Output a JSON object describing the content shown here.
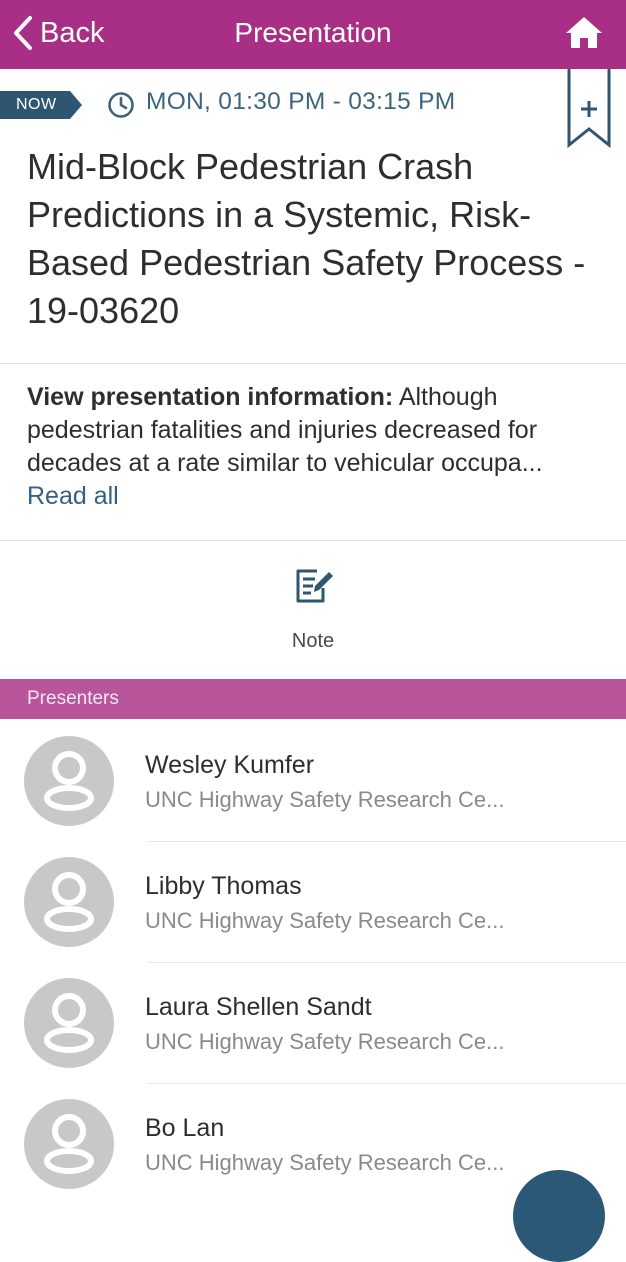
{
  "header": {
    "back_label": "Back",
    "title": "Presentation"
  },
  "session": {
    "now_badge": "NOW",
    "time": "MON, 01:30 PM - 03:15 PM",
    "title": "Mid-Block Pedestrian Crash Predictions in a Systemic, Risk-Based Pedestrian Safety Process - 19-03620",
    "description_label": "View presentation information:",
    "description_text": " Although pedestrian fatalities and injuries decreased for decades at a rate similar to vehicular occupa...",
    "read_all": "Read all"
  },
  "actions": {
    "note_label": "Note"
  },
  "presenters": {
    "section_label": "Presenters",
    "items": [
      {
        "name": "Wesley Kumfer",
        "org": "UNC Highway Safety Research Ce..."
      },
      {
        "name": "Libby Thomas",
        "org": "UNC Highway Safety Research Ce..."
      },
      {
        "name": "Laura Shellen Sandt",
        "org": "UNC Highway Safety Research Ce..."
      },
      {
        "name": "Bo Lan",
        "org": "UNC Highway Safety Research Ce..."
      }
    ]
  },
  "colors": {
    "header_bg": "#a92f86",
    "section_bg": "#b8559b",
    "accent_blue": "#3d6580",
    "badge_bg": "#2f5670"
  },
  "icons": {
    "back": "chevron-left-icon",
    "home": "home-icon",
    "clock": "clock-icon",
    "bookmark": "bookmark-add-icon",
    "note": "edit-note-icon",
    "avatar": "user-placeholder-icon"
  }
}
